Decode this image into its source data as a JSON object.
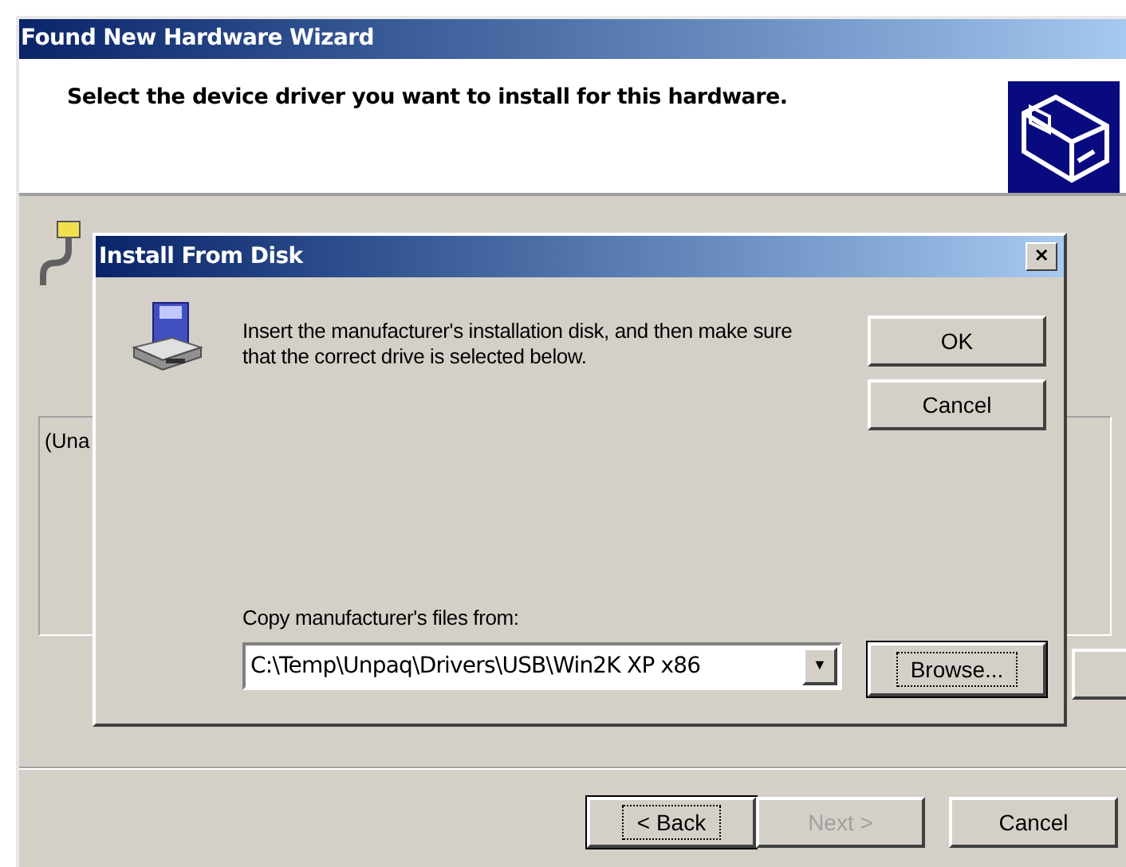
{
  "wizard": {
    "title": "Found New Hardware Wizard",
    "heading": "Select the device driver you want to install for this hardware.",
    "list_text": "(Una",
    "buttons": [
      {
        "label": "< Back",
        "disabled": false,
        "focused": true
      },
      {
        "label": "Next >",
        "disabled": true,
        "focused": false
      },
      {
        "label": "Cancel",
        "disabled": false,
        "focused": false
      }
    ]
  },
  "dialog": {
    "title": "Install From Disk",
    "close": "✕",
    "message": "Insert the manufacturer's installation disk, and then make sure that the correct drive is selected below.",
    "buttons": [
      {
        "label": "OK",
        "focused": false
      },
      {
        "label": "Cancel",
        "focused": false
      }
    ],
    "field_label": "Copy manufacturer's files from:",
    "path": "C:\\Temp\\Unpaq\\Drivers\\USB\\Win2K XP x86",
    "dropdown": "▼",
    "browse": {
      "label": "Browse...",
      "focused": true
    }
  }
}
